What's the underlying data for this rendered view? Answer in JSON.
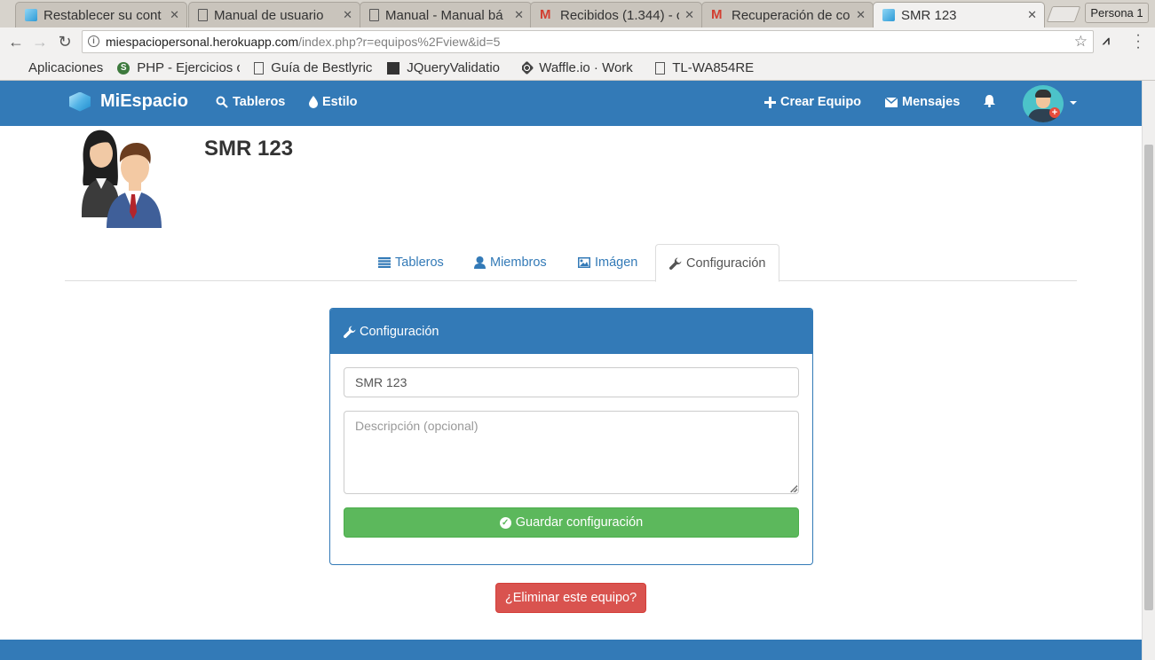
{
  "browser": {
    "tabs": [
      {
        "title": "Restablecer su cont",
        "favicon": "cube-icon",
        "active": false
      },
      {
        "title": "Manual de usuario",
        "favicon": "document-icon",
        "active": false
      },
      {
        "title": "Manual - Manual bá",
        "favicon": "document-icon",
        "active": false
      },
      {
        "title": "Recibidos (1.344) - c",
        "favicon": "gmail-icon",
        "active": false
      },
      {
        "title": "Recuperación de co",
        "favicon": "gmail-icon",
        "active": false
      },
      {
        "title": "SMR 123",
        "favicon": "cube-icon",
        "active": true
      }
    ],
    "profile_label": "Persona 1",
    "url_host": "miespaciopersonal.herokuapp.com",
    "url_path": "/index.php?r=equipos%2Fview&id=5",
    "bookmarks": [
      {
        "label": "Aplicaciones",
        "icon": "apps-grid-icon"
      },
      {
        "label": "PHP - Ejercicios c",
        "icon": "php-icon"
      },
      {
        "label": "Guía de Bestlyric",
        "icon": "document-icon"
      },
      {
        "label": "JQueryValidatio",
        "icon": "jquery-icon"
      },
      {
        "label": "Waffle.io · Work",
        "icon": "waffle-icon"
      },
      {
        "label": "TL-WA854RE",
        "icon": "document-icon"
      }
    ]
  },
  "app": {
    "brand": "MiEspacio",
    "nav": {
      "boards": "Tableros",
      "style": "Estilo",
      "create_team": "Crear Equipo",
      "messages": "Mensajes"
    },
    "colors": {
      "primary": "#337ab7",
      "success": "#5cb85c",
      "danger": "#d9534f"
    }
  },
  "team": {
    "name": "SMR 123",
    "tabs": {
      "boards": "Tableros",
      "members": "Miembros",
      "image": "Imágen",
      "settings": "Configuración"
    },
    "active_tab": "Configuración"
  },
  "settings_panel": {
    "title": "Configuración",
    "name_value": "SMR 123",
    "description_placeholder": "Descripción (opcional)",
    "save_label": "Guardar configuración"
  },
  "delete_label": "¿Eliminar este equipo?"
}
